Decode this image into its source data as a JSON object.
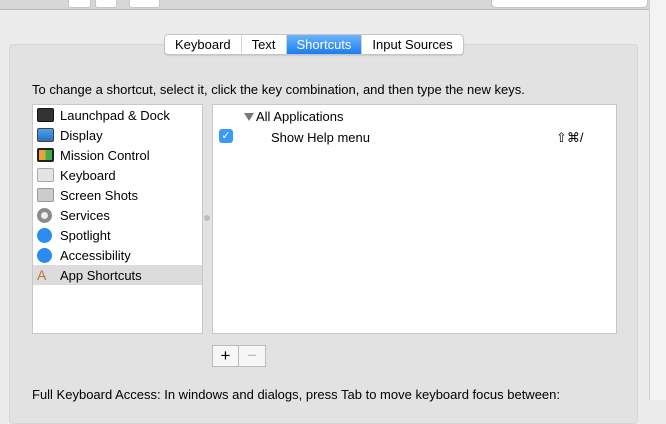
{
  "tabs": [
    {
      "label": "Keyboard"
    },
    {
      "label": "Text"
    },
    {
      "label": "Shortcuts",
      "active": true
    },
    {
      "label": "Input Sources"
    }
  ],
  "instructions": "To change a shortcut, select it, click the key combination, and then type the new keys.",
  "categories": [
    {
      "label": "Launchpad & Dock",
      "icon": "launchpad-icon"
    },
    {
      "label": "Display",
      "icon": "display-icon"
    },
    {
      "label": "Mission Control",
      "icon": "mission-control-icon"
    },
    {
      "label": "Keyboard",
      "icon": "keyboard-icon"
    },
    {
      "label": "Screen Shots",
      "icon": "screenshot-icon"
    },
    {
      "label": "Services",
      "icon": "gear-icon"
    },
    {
      "label": "Spotlight",
      "icon": "spotlight-icon"
    },
    {
      "label": "Accessibility",
      "icon": "accessibility-icon"
    },
    {
      "label": "App Shortcuts",
      "icon": "app-shortcuts-icon",
      "selected": true
    }
  ],
  "shortcuts": {
    "group": "All Applications",
    "rows": [
      {
        "checked": true,
        "label": "Show Help menu",
        "keys": "⇧⌘/"
      }
    ]
  },
  "buttons": {
    "add": "+",
    "remove": "−"
  },
  "full_keyboard_access": "Full Keyboard Access: In windows and dialogs, press Tab to move keyboard focus between:",
  "colors": {
    "accent": "#1a7cf4",
    "selection": "#dcdcdc"
  }
}
